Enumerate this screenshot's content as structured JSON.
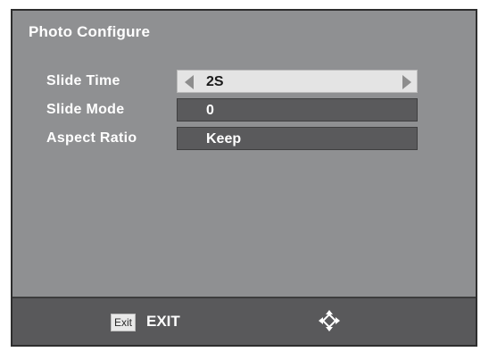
{
  "panel": {
    "title": "Photo Configure"
  },
  "settings": [
    {
      "label": "Slide Time",
      "value": "2S",
      "selected": true
    },
    {
      "label": "Slide Mode",
      "value": "0",
      "selected": false
    },
    {
      "label": "Aspect Ratio",
      "value": "Keep",
      "selected": false
    }
  ],
  "footer": {
    "exit_key": "Exit",
    "exit_label": "EXIT",
    "nav_icon": "navigation-arrows-icon"
  },
  "colors": {
    "panel_bg": "#8f9092",
    "footer_bg": "#59595b",
    "selected_field": "#e4e4e4",
    "field_bg": "#5a5a5c"
  }
}
